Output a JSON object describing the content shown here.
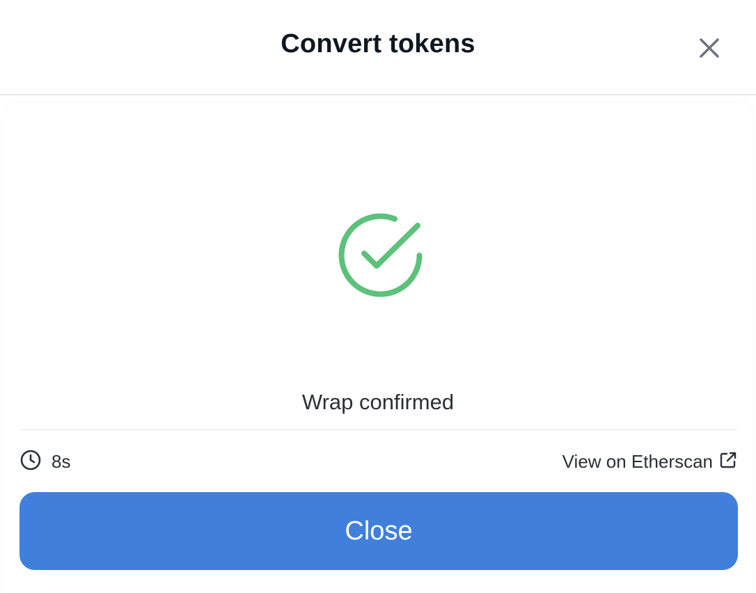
{
  "modal": {
    "title": "Convert tokens",
    "close_icon": "close-icon"
  },
  "status": {
    "icon": "check-circle-icon",
    "icon_color": "#5cc17a",
    "message": "Wrap confirmed"
  },
  "footer": {
    "elapsed_icon": "clock-icon",
    "elapsed_time": "8s",
    "explorer_link_label": "View on Etherscan",
    "explorer_link_icon": "external-link-icon"
  },
  "actions": {
    "close_label": "Close",
    "close_color": "#407fdc"
  }
}
